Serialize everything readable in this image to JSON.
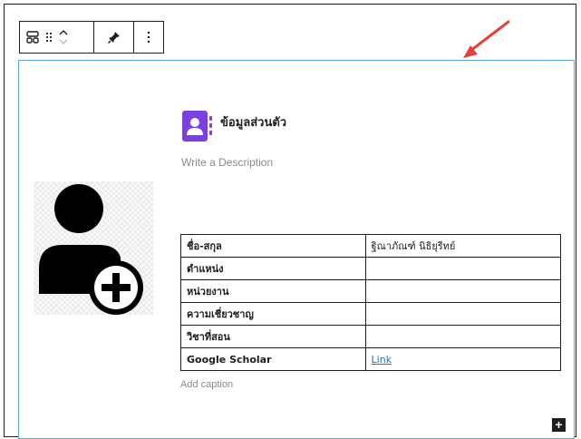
{
  "toolbar": {
    "icons": [
      "block-type-icon",
      "drag-handle-icon",
      "move-up-down-icon",
      "pin-icon",
      "more-options-icon"
    ]
  },
  "block": {
    "title": "ข้อมูลส่วนตัว",
    "description_placeholder": "Write a Description",
    "caption_placeholder": "Add caption",
    "add_button": "+"
  },
  "table": {
    "rows": [
      {
        "label": "ชื่อ-สกุล",
        "value": "ฐิณาภัณฑ์ นิธิยุรีทย์"
      },
      {
        "label": "ตำแหน่ง",
        "value": ""
      },
      {
        "label": "หน่วยงาน",
        "value": ""
      },
      {
        "label": "ความเชี่ยวชาญ",
        "value": ""
      },
      {
        "label": "วิชาที่สอน",
        "value": ""
      },
      {
        "label": "Google Scholar",
        "value": "Link"
      }
    ]
  },
  "colors": {
    "accent": "#7b3fe4",
    "selection_border": "#5aa9e6",
    "arrow": "#e0443a",
    "link": "#1e73be"
  }
}
